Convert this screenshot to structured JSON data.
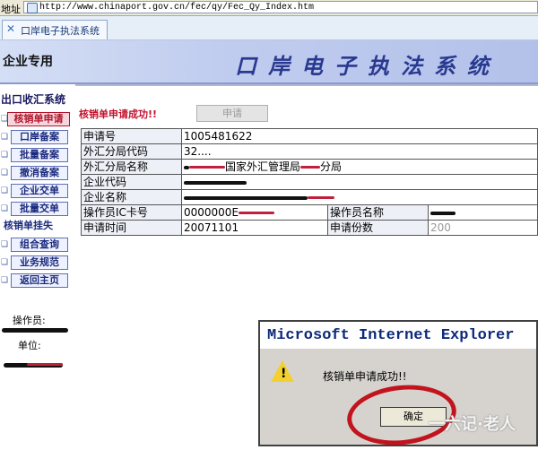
{
  "address_bar": {
    "label": "地址",
    "url": "http://www.chinaport.gov.cn/fec/qy/Fec_Qy_Index.htm"
  },
  "tab": {
    "title": "口岸电子执法系统"
  },
  "banner": {
    "user_type": "企业专用",
    "system_title": "口岸电子执法系统"
  },
  "sidebar": {
    "heading": "出口收汇系统",
    "items": [
      {
        "label": "核销单申请",
        "active": true
      },
      {
        "label": "口岸备案"
      },
      {
        "label": "批量备案"
      },
      {
        "label": "撤消备案"
      },
      {
        "label": "企业交单"
      },
      {
        "label": "批量交单"
      },
      {
        "label": "核销单挂失"
      },
      {
        "label": "组合查询"
      },
      {
        "label": "业务规范"
      },
      {
        "label": "返回主页"
      }
    ],
    "operator_label": "操作员:",
    "unit_label": "单位:"
  },
  "main": {
    "success_message": "核销单申请成功!!",
    "submit_button": "申请",
    "table": {
      "application_no": {
        "label": "申请号",
        "value": "1005481622"
      },
      "forex_branch_code": {
        "label": "外汇分局代码",
        "value": "32...."
      },
      "forex_branch_name": {
        "label": "外汇分局名称",
        "value_mid": "国家外汇管理局",
        "value_end": "分局"
      },
      "company_code": {
        "label": "企业代码",
        "value": ""
      },
      "company_name": {
        "label": "企业名称",
        "value": ""
      },
      "operator_ic": {
        "label": "操作员IC卡号",
        "value": "0000000E",
        "label2": "操作员名称",
        "value2": ""
      },
      "apply_time": {
        "label": "申请时间",
        "value": "20071101",
        "label2": "申请份数",
        "value2": "200"
      }
    }
  },
  "dialog": {
    "title": "Microsoft Internet Explorer",
    "message": "核销单申请成功!!",
    "ok_button": "确定"
  },
  "watermark": "一六记·老人",
  "colors": {
    "accent_red": "#c4112d",
    "banner_blue": "#2a3990",
    "dialog_bg": "#d6d3ce"
  }
}
